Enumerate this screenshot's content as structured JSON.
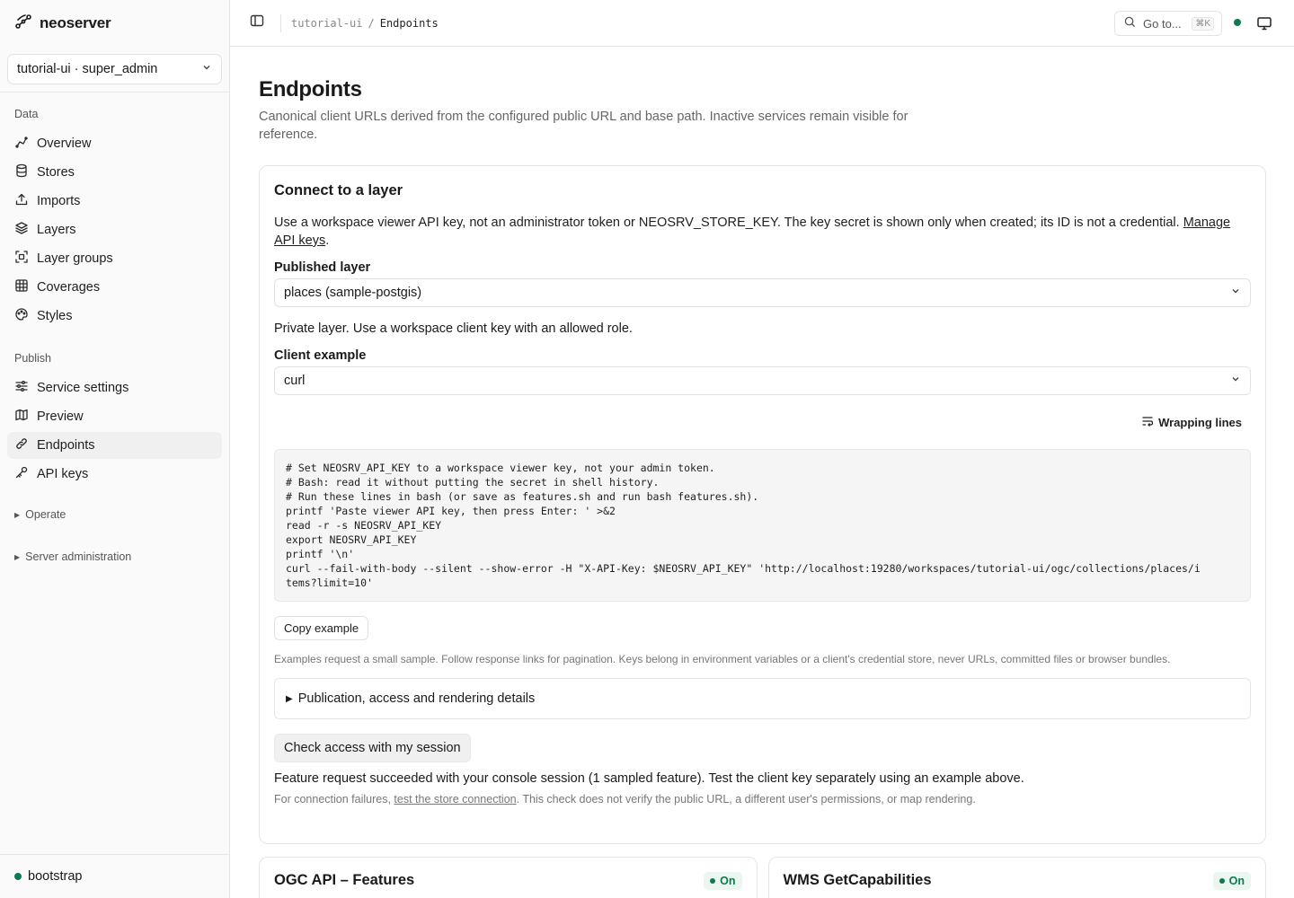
{
  "app": {
    "name": "neoserver"
  },
  "workspace_selector": {
    "value": "tutorial-ui · super_admin"
  },
  "sidebar": {
    "data_label": "Data",
    "data_items": [
      {
        "label": "Overview",
        "icon": "overview-icon"
      },
      {
        "label": "Stores",
        "icon": "database-icon"
      },
      {
        "label": "Imports",
        "icon": "upload-icon"
      },
      {
        "label": "Layers",
        "icon": "layers-icon"
      },
      {
        "label": "Layer groups",
        "icon": "layer-groups-icon"
      },
      {
        "label": "Coverages",
        "icon": "grid-icon"
      },
      {
        "label": "Styles",
        "icon": "palette-icon"
      }
    ],
    "publish_label": "Publish",
    "publish_items": [
      {
        "label": "Service settings",
        "icon": "sliders-icon"
      },
      {
        "label": "Preview",
        "icon": "map-icon"
      },
      {
        "label": "Endpoints",
        "icon": "link-icon",
        "active": true
      },
      {
        "label": "API keys",
        "icon": "key-icon"
      }
    ],
    "operate_label": "Operate",
    "server_admin_label": "Server administration",
    "footer_status": "bootstrap"
  },
  "topbar": {
    "breadcrumb_parent": "tutorial-ui",
    "breadcrumb_sep": "/",
    "breadcrumb_current": "Endpoints",
    "goto_label": "Go to...",
    "goto_shortcut": "⌘K"
  },
  "page": {
    "title": "Endpoints",
    "description": "Canonical client URLs derived from the configured public URL and base path. Inactive services remain visible for reference."
  },
  "connect": {
    "title": "Connect to a layer",
    "hint_text": "Use a workspace viewer API key, not an administrator token or NEOSRV_STORE_KEY. The key secret is shown only when created; its ID is not a credential. ",
    "hint_link": "Manage API keys",
    "hint_end": ".",
    "published_layer_label": "Published layer",
    "published_layer_value": "places (sample-postgis)",
    "private_note": "Private layer. Use a workspace client key with an allowed role.",
    "client_example_label": "Client example",
    "client_example_value": "curl",
    "wrap_label": "Wrapping lines",
    "code": "# Set NEOSRV_API_KEY to a workspace viewer key, not your admin token.\n# Bash: read it without putting the secret in shell history.\n# Run these lines in bash (or save as features.sh and run bash features.sh).\nprintf 'Paste viewer API key, then press Enter: ' >&2\nread -r -s NEOSRV_API_KEY\nexport NEOSRV_API_KEY\nprintf '\\n'\ncurl --fail-with-body --silent --show-error -H \"X-API-Key: $NEOSRV_API_KEY\" 'http://localhost:19280/workspaces/tutorial-ui/ogc/collections/places/i\ntems?limit=10'",
    "copy_button": "Copy example",
    "examples_note": "Examples request a small sample. Follow response links for pagination. Keys belong in environment variables or a client's credential store, never URLs, committed files or browser bundles.",
    "details_label": "Publication, access and rendering details",
    "check_button": "Check access with my session",
    "result_text": "Feature request succeeded with your console session (1 sampled feature). Test the client key separately using an example above.",
    "foot_prefix": "For connection failures, ",
    "foot_link": "test the store connection",
    "foot_suffix": ". This check does not verify the public URL, a different user's permissions, or map rendering."
  },
  "services": [
    {
      "title": "OGC API – Features",
      "status": "On"
    },
    {
      "title": "WMS GetCapabilities",
      "status": "On"
    }
  ],
  "colors": {
    "status_green": "#0e7a4e",
    "badge_bg": "#eaf6ef"
  }
}
